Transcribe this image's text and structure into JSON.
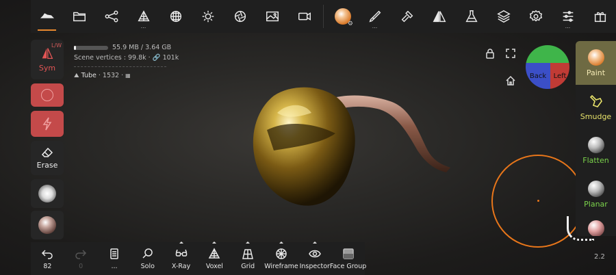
{
  "topbar": {
    "items": [
      {
        "name": "scene-icon"
      },
      {
        "name": "folder-icon"
      },
      {
        "name": "graph-icon"
      },
      {
        "name": "topology-icon",
        "dots": "..."
      },
      {
        "name": "grid-sphere-icon"
      },
      {
        "name": "sun-icon"
      },
      {
        "name": "aperture-icon"
      },
      {
        "name": "image-icon"
      },
      {
        "name": "camera-icon"
      }
    ],
    "right_items": [
      {
        "name": "material-ball-icon"
      },
      {
        "name": "brush-icon",
        "dots": "..."
      },
      {
        "name": "hammer-icon"
      },
      {
        "name": "symmetry-icon"
      },
      {
        "name": "flask-icon"
      },
      {
        "name": "layers-icon"
      },
      {
        "name": "settings-icon"
      },
      {
        "name": "sliders-icon",
        "dots": "..."
      },
      {
        "name": "gift-icon"
      }
    ]
  },
  "leftbar": {
    "sym_label": "Sym",
    "sym_badge": "L/W",
    "erase_label": "Erase"
  },
  "info": {
    "memory": "55.9 MB / 3.64 GB",
    "memory_fraction": 0.015,
    "vertices_label": "Scene vertices :",
    "vertices": "99.8k",
    "vertices_total": "101k",
    "object_name": "Tube",
    "object_count": "1532"
  },
  "cube": {
    "back": "Back",
    "left": "Left"
  },
  "rightbar": {
    "items": [
      {
        "label": "Paint",
        "active": true
      },
      {
        "label": "Smudge"
      },
      {
        "label": "Flatten"
      },
      {
        "label": "Planar"
      }
    ]
  },
  "bottombar": {
    "undo_count": "82",
    "redo_count": "0",
    "more_label": "...",
    "solo": "Solo",
    "xray": "X-Ray",
    "voxel": "Voxel",
    "grid": "Grid",
    "wireframe": "Wireframe",
    "inspector": "Inspector",
    "facegroup": "Face Group"
  },
  "version": "2.2",
  "colors": {
    "accent": "#e8892e",
    "sym_red": "#e25555",
    "active_red": "#c44a4a",
    "paint_active": "#6e6a43",
    "smudge_yellow": "#e8e36a",
    "flatten_green": "#7bd34b",
    "brush_circle": "#e8761a"
  }
}
